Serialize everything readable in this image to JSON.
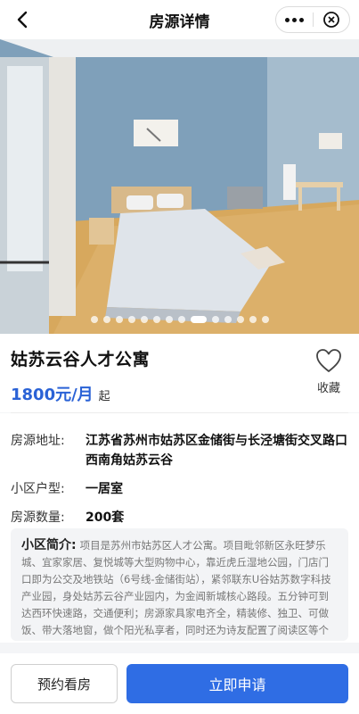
{
  "nav": {
    "title": "房源详情"
  },
  "carousel": {
    "count": 14,
    "active_index": 8
  },
  "listing": {
    "title": "姑苏云谷人才公寓",
    "price": "1800元/月",
    "price_suffix": "起",
    "favorite_label": "收藏"
  },
  "details": {
    "address_label": "房源地址:",
    "address_value": "江苏省苏州市姑苏区金储街与长泾塘街交叉路口西南角姑苏云谷",
    "layout_label": "小区户型:",
    "layout_value": "一居室",
    "count_label": "房源数量:",
    "count_value": "200套"
  },
  "intro": {
    "title": "小区简介:",
    "text": "项目是苏州市姑苏区人才公寓。项目毗邻新区永旺梦乐城、宜家家居、复悦城等大型购物中心，靠近虎丘湿地公园，门店门口即为公交及地铁站（6号线-金储街站），紧邻联东U谷姑苏数字科技产业园，身处姑苏云谷产业园内，为金阊新城核心路段。五分钟可到达西环快速路，交通便利；房源家具家电齐全，精装修、独卫、可做饭、带大落地窗，做个阳光私享者，同时还为诗友配置了阅读区等个性化设施，让您真切住进好时光~"
  },
  "actions": {
    "reserve_label": "预约看房",
    "apply_label": "立即申请"
  },
  "colors": {
    "accent": "#2f6de4",
    "price": "#2a62d6"
  }
}
